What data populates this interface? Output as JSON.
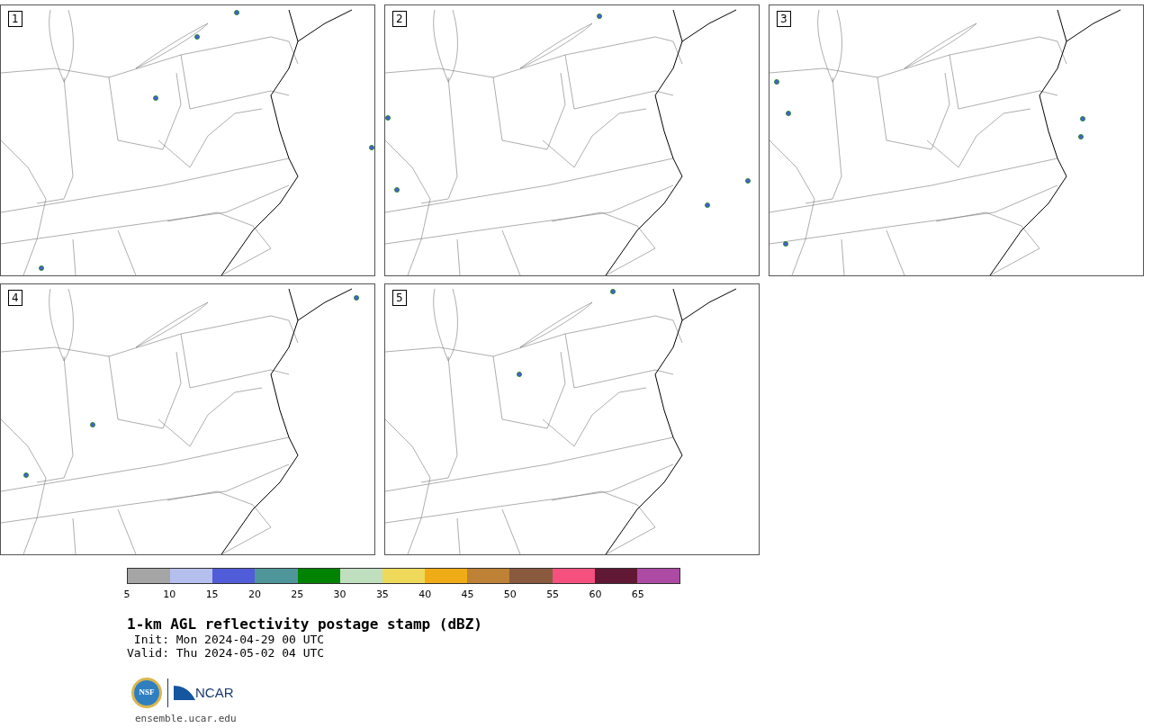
{
  "panels": [
    {
      "label": "1"
    },
    {
      "label": "2"
    },
    {
      "label": "3"
    },
    {
      "label": "4"
    },
    {
      "label": "5"
    }
  ],
  "colorbar": {
    "bins": [
      {
        "color": "#a5a5a5",
        "label": "5"
      },
      {
        "color": "#b5bfed",
        "label": "10"
      },
      {
        "color": "#505cd8",
        "label": "15"
      },
      {
        "color": "#4f969b",
        "label": "20"
      },
      {
        "color": "#018301",
        "label": "25"
      },
      {
        "color": "#bfdfbf",
        "label": "30"
      },
      {
        "color": "#eed95a",
        "label": "35"
      },
      {
        "color": "#f0ac16",
        "label": "40"
      },
      {
        "color": "#bd8235",
        "label": "45"
      },
      {
        "color": "#8a5a3f",
        "label": "50"
      },
      {
        "color": "#f5507e",
        "label": "55"
      },
      {
        "color": "#601834",
        "label": "60"
      },
      {
        "color": "#ad4aa3",
        "label": "65"
      }
    ]
  },
  "title": "1-km AGL reflectivity postage stamp (dBZ)",
  "init": " Init: Mon 2024-04-29 00 UTC",
  "valid": "Valid: Thu 2024-05-02 04 UTC",
  "logos": {
    "nsf": "NSF",
    "ncar": "NCAR"
  },
  "website": "ensemble.ucar.edu"
}
